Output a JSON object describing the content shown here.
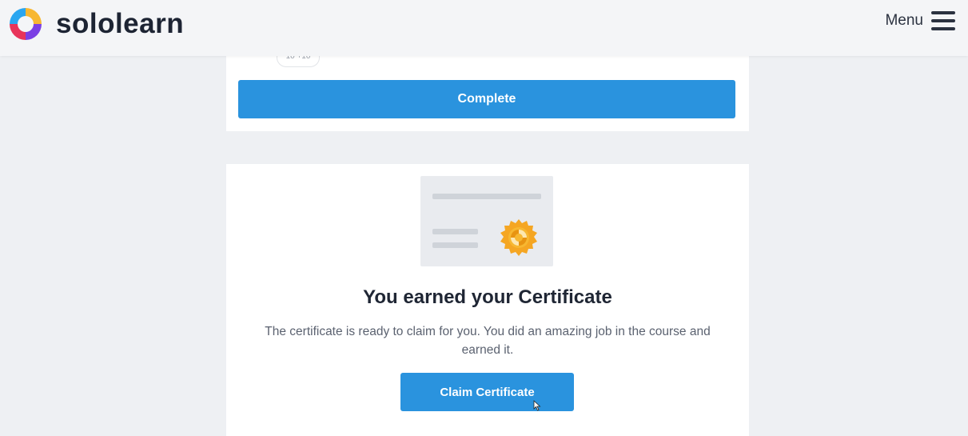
{
  "header": {
    "brand": "sololearn",
    "menu_label": "Menu"
  },
  "lesson_card": {
    "xp_chip": "10 +10",
    "complete_label": "Complete"
  },
  "certificate_card": {
    "title": "You earned your Certificate",
    "description": "The certificate is ready to claim for you. You did an amazing job in the course and earned it.",
    "claim_label": "Claim Certificate"
  },
  "colors": {
    "primary_button": "#2a93de",
    "seal": "#f5a623",
    "page_bg": "#eef0f3"
  },
  "icons": [
    "sololearn-logo-icon",
    "hamburger-menu-icon",
    "certificate-seal-icon",
    "mouse-cursor-icon"
  ]
}
